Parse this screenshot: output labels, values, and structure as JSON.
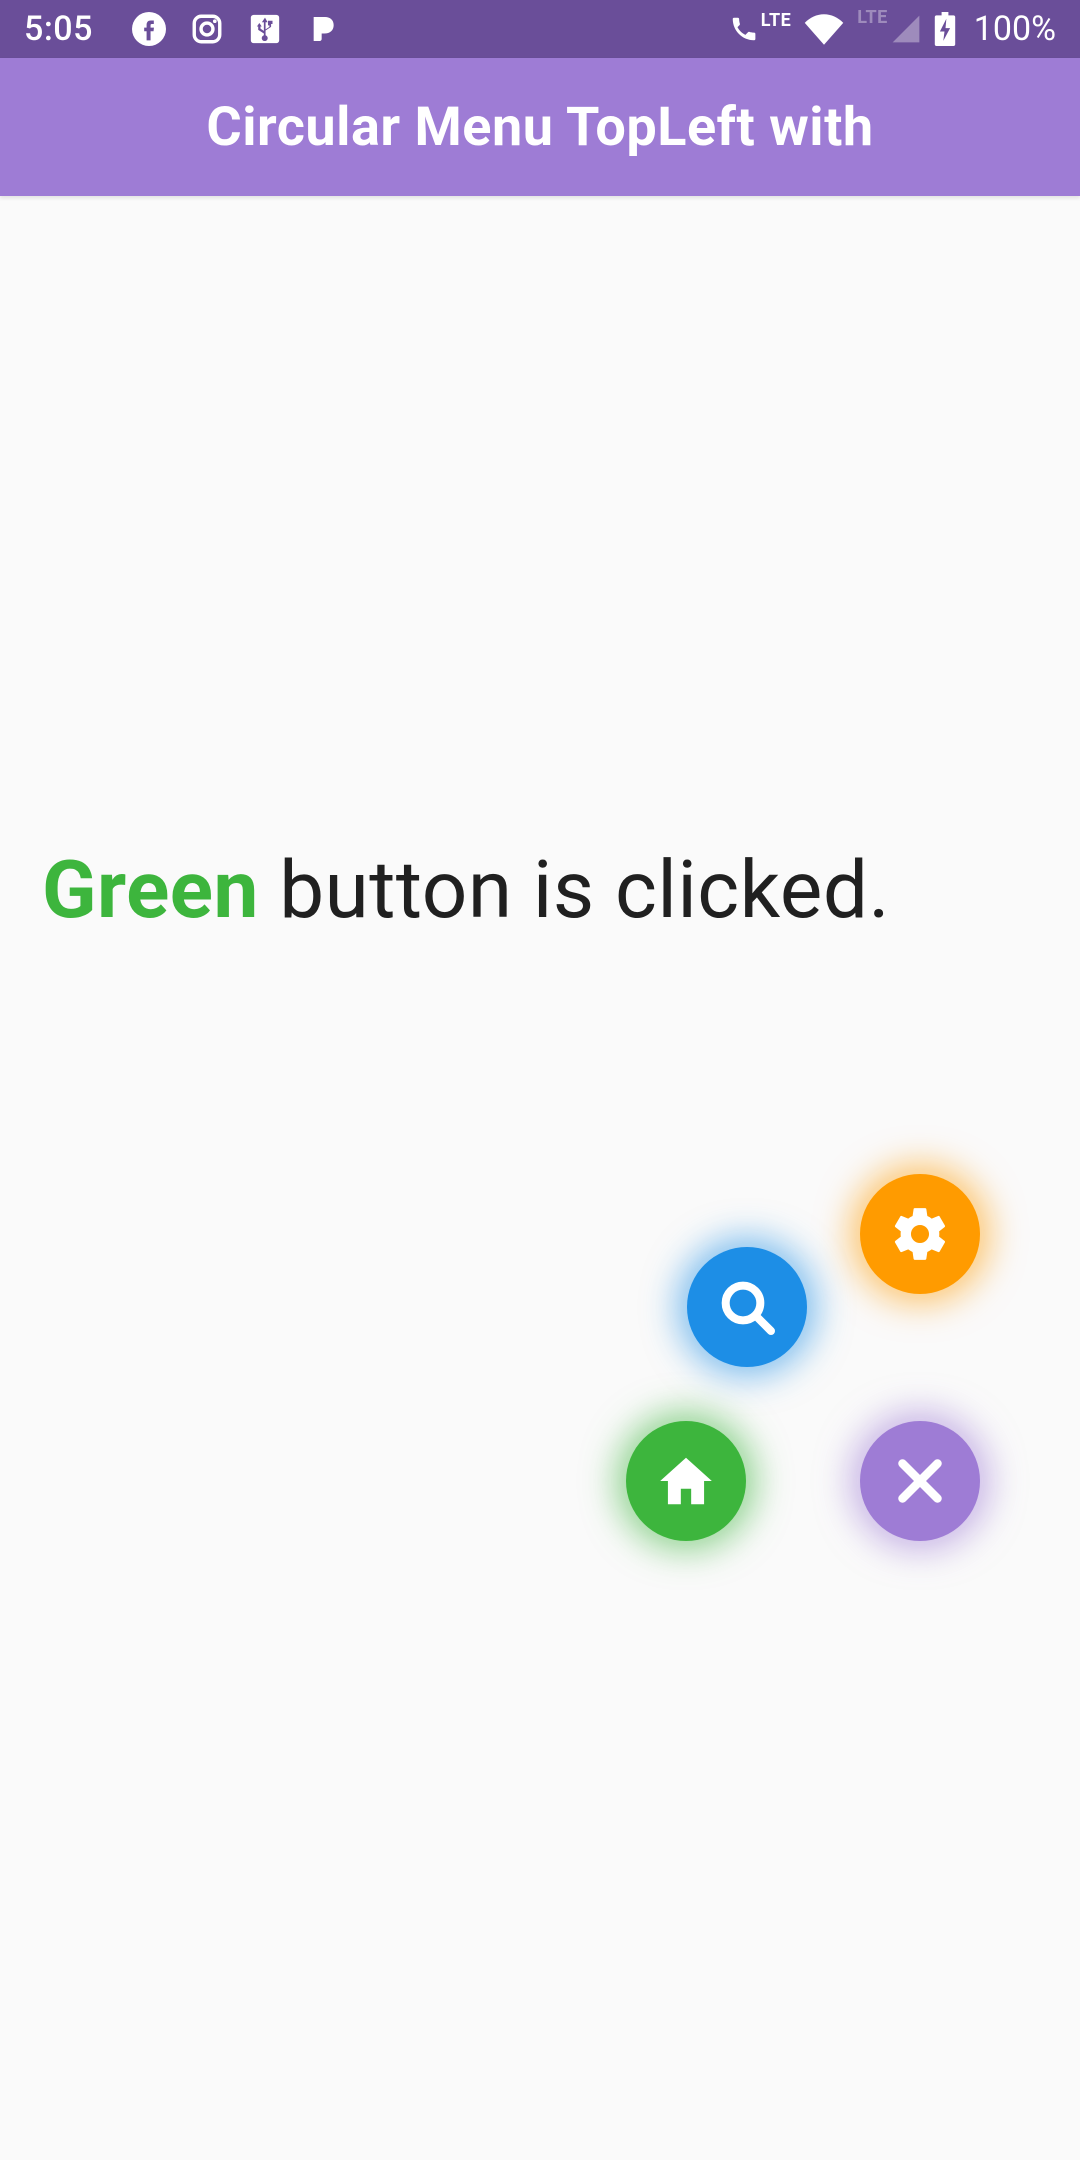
{
  "status_bar": {
    "time": "5:05",
    "lte_left": "LTE",
    "lte_right": "LTE",
    "battery_pct": "100%",
    "icons": {
      "facebook": "facebook-icon",
      "instagram": "instagram-icon",
      "usb": "usb-icon",
      "pandora": "pandora-icon",
      "phone": "phone-icon",
      "wifi": "wifi-icon",
      "signal": "signal-icon",
      "battery": "battery-charging-icon"
    }
  },
  "app_bar": {
    "title": "Circular Menu TopLeft with"
  },
  "content": {
    "status_sentence": {
      "color_word": "Green",
      "rest": " button is clicked."
    }
  },
  "fab_menu": {
    "items": [
      {
        "name": "settings",
        "color": "orange",
        "icon": "gear-icon"
      },
      {
        "name": "search",
        "color": "blue",
        "icon": "search-icon"
      },
      {
        "name": "home",
        "color": "green",
        "icon": "home-icon"
      },
      {
        "name": "close",
        "color": "purple",
        "icon": "close-icon"
      }
    ]
  },
  "colors": {
    "status_bar_bg": "#6a4e99",
    "app_bar_bg": "#9e7cd5",
    "green": "#3db53d",
    "blue": "#1d8ee6",
    "orange": "#ff9b00",
    "purple": "#9e7cd5"
  }
}
